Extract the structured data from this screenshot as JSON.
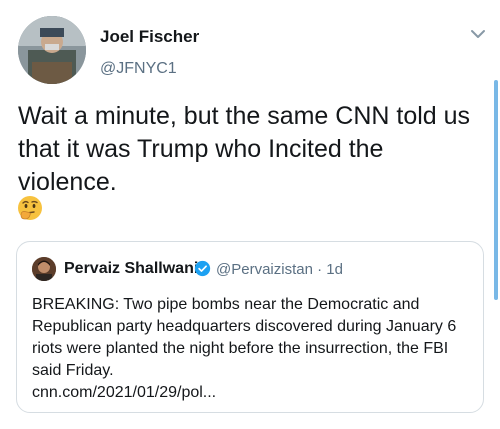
{
  "author": {
    "display_name": "Joel Fischer",
    "handle": "@JFNYC1"
  },
  "tweet": {
    "text": "Wait a minute, but the same CNN told us that it was Trump who Incited the violence.",
    "emoji": "thinking-face"
  },
  "quoted": {
    "display_name": "Pervaiz Shallwani",
    "verified": true,
    "meta": "@Pervaizistan · 1d",
    "text": "BREAKING: Two pipe bombs near the Democratic and Republican party headquarters discovered during January 6 riots were planted the night before the insurrection, the FBI said Friday.",
    "link": "cnn.com/2021/01/29/pol..."
  },
  "colors": {
    "text_primary": "#14171a",
    "text_secondary": "#5b7083",
    "verified_blue": "#1da1f2",
    "border": "#d6dde2"
  },
  "icons": {
    "menu": "chevron-down-icon",
    "verified": "verified-badge-icon"
  }
}
